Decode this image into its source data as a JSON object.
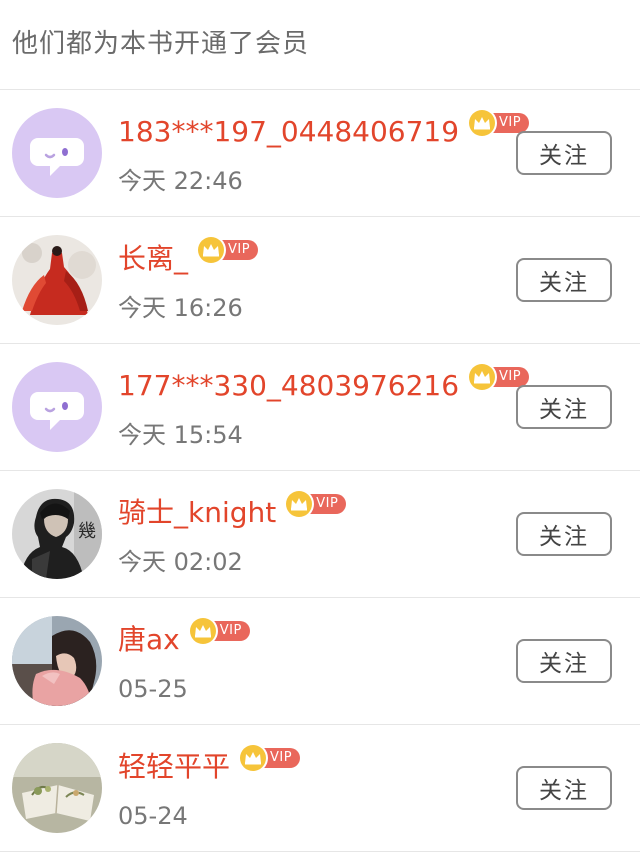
{
  "header": {
    "title": "他们都为本书开通了会员"
  },
  "vip": {
    "label": "VIP",
    "crown_color": "#f6c43a",
    "badge_color": "#e9675b"
  },
  "colors": {
    "name": "#e2452b",
    "time": "#777777",
    "divider": "#e6e6e6"
  },
  "members": [
    {
      "name": "183***197_0448406719",
      "time": "今天 22:46",
      "avatar": "default-purple-chat-avatar",
      "follow_label": "关注"
    },
    {
      "name": "长离_",
      "time": "今天 16:26",
      "avatar": "red-robed-figure-avatar",
      "follow_label": "关注"
    },
    {
      "name": "177***330_4803976216",
      "time": "今天 15:54",
      "avatar": "default-purple-chat-avatar",
      "follow_label": "关注"
    },
    {
      "name": "骑士_knight",
      "time": "今天 02:02",
      "avatar": "dark-jacket-person-avatar",
      "follow_label": "关注"
    },
    {
      "name": "唐ax",
      "time": "05-25",
      "avatar": "girl-in-car-avatar",
      "follow_label": "关注"
    },
    {
      "name": "轻轻平平",
      "time": "05-24",
      "avatar": "book-and-flowers-avatar",
      "follow_label": "关注"
    }
  ]
}
